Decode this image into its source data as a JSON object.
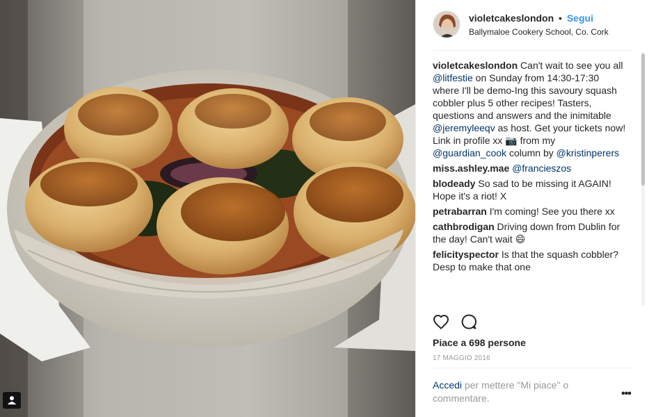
{
  "post": {
    "username": "violetcakeslondon",
    "separator": "•",
    "follow_label": "Segui",
    "location": "Ballymaloe Cookery School, Co. Cork"
  },
  "comments": [
    {
      "user": "violetcakeslondon",
      "parts": [
        {
          "t": "text",
          "v": " Can't wait to see you all "
        },
        {
          "t": "mention",
          "v": "@litfestie"
        },
        {
          "t": "text",
          "v": " on Sunday from 14:30-17:30 where I'll be demo-Ing this savoury squash cobbler plus 5 other recipes! Tasters, questions and answers and the inimitable "
        },
        {
          "t": "mention",
          "v": "@jeremyleeqv"
        },
        {
          "t": "text",
          "v": " as host. Get your tickets now! Link in profile xx 📷 from my "
        },
        {
          "t": "mention",
          "v": "@guardian_cook"
        },
        {
          "t": "text",
          "v": " column by "
        },
        {
          "t": "mention",
          "v": "@kristinperers"
        }
      ]
    },
    {
      "user": "miss.ashley.mae",
      "parts": [
        {
          "t": "text",
          "v": " "
        },
        {
          "t": "mention",
          "v": "@francieszos"
        }
      ]
    },
    {
      "user": "blodeady",
      "parts": [
        {
          "t": "text",
          "v": " So sad to be missing it AGAIN! Hope it's a riot! X"
        }
      ]
    },
    {
      "user": "petrabarran",
      "parts": [
        {
          "t": "text",
          "v": " I'm coming! See you there xx"
        }
      ]
    },
    {
      "user": "cathbrodigan",
      "parts": [
        {
          "t": "text",
          "v": " Driving down from Dublin for the day! Can't wait 😄"
        }
      ]
    },
    {
      "user": "felicityspector",
      "parts": [
        {
          "t": "text",
          "v": " Is that the squash cobbler? Desp to make that one"
        }
      ]
    }
  ],
  "likes_text": "Piace a 698 persone",
  "date": "17 MAGGIO 2016",
  "login": {
    "link": "Accedi",
    "rest": " per mettere \"Mi piace\" o commentare."
  },
  "more_label": "•••",
  "icons": {
    "like": "heart-icon",
    "comment": "comment-icon",
    "tag": "person-tag-icon",
    "more": "more-options-icon"
  },
  "colors": {
    "link_blue": "#3897f0",
    "mention": "#003569",
    "muted": "#999999",
    "text": "#262626"
  }
}
